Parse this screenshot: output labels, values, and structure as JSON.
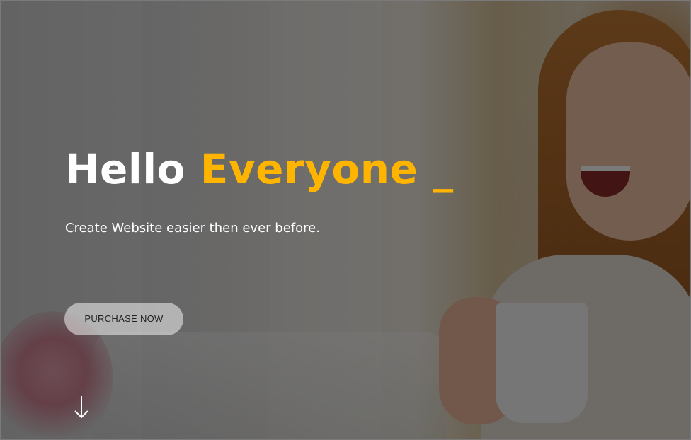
{
  "hero": {
    "headline_part1": "Hello",
    "headline_part2": "Everyone",
    "headline_cursor": "_",
    "subtitle": "Create Website easier then ever before.",
    "cta_label": "PURCHASE NOW",
    "scroll_icon": "arrow-down-icon"
  },
  "colors": {
    "accent": "#ffb400",
    "headline_white": "#ffffff",
    "overlay": "rgba(0,0,0,0.52)"
  }
}
